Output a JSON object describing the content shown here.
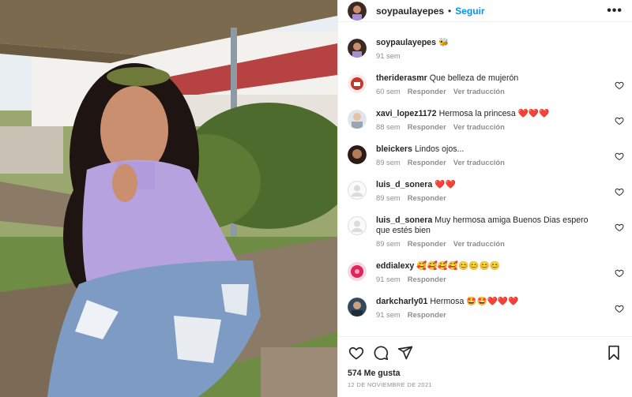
{
  "post": {
    "username": "soypaulayepes",
    "follow_label": "Seguir",
    "separator": "•",
    "caption_emoji": "🐝",
    "caption_time": "91 sem",
    "likes_text": "574 Me gusta",
    "date_text": "12 de noviembre de 2021"
  },
  "comments": [
    {
      "user": "theriderasmr",
      "text": "Que belleza de mujerón",
      "time": "60 sem",
      "reply": "Responder",
      "translate": "Ver traducción",
      "avatar_color": "#c0392b"
    },
    {
      "user": "xavi_lopez1172",
      "text": "Hermosa la princesa ❤️❤️❤️",
      "time": "88 sem",
      "reply": "Responder",
      "translate": "Ver traducción",
      "avatar_color": "#a7b3bf"
    },
    {
      "user": "bleickers",
      "text": "Lindos ojos...",
      "time": "89 sem",
      "reply": "Responder",
      "translate": "Ver traducción",
      "avatar_color": "#5a3d2b"
    },
    {
      "user": "luis_d_sonera",
      "text": "❤️❤️",
      "time": "89 sem",
      "reply": "Responder",
      "translate": "",
      "avatar_color": "#dbdbdb"
    },
    {
      "user": "luis_d_sonera",
      "text": "Muy hermosa amiga Buenos Dias espero que estés bien",
      "time": "89 sem",
      "reply": "Responder",
      "translate": "Ver traducción",
      "avatar_color": "#dbdbdb"
    },
    {
      "user": "eddialexy",
      "text": "🥰🥰🥰🥰😊😊😊😊",
      "time": "91 sem",
      "reply": "Responder",
      "translate": "",
      "avatar_color": "#e0245e"
    },
    {
      "user": "darkcharly01",
      "text": "Hermosa 🤩🤩❤️❤️❤️",
      "time": "91 sem",
      "reply": "Responder",
      "translate": "",
      "avatar_color": "#34495e"
    }
  ],
  "icons": {
    "more": "more-options-icon",
    "like": "heart-icon",
    "comment": "comment-icon",
    "share": "share-icon",
    "save": "bookmark-icon"
  },
  "colors": {
    "accent": "#0095f6",
    "heart": "#ed4956",
    "text": "#262626",
    "muted": "#8e8e8e"
  }
}
